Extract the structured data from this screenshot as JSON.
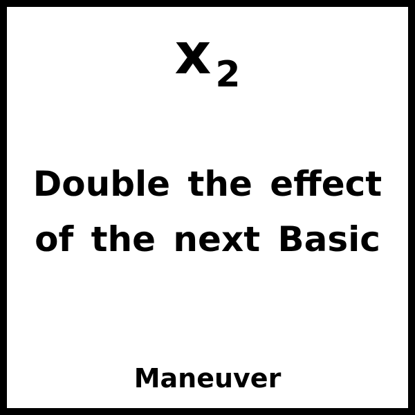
{
  "card": {
    "symbol": {
      "main": "x",
      "subscript": "2"
    },
    "effect_lines": [
      "Double the effect",
      "of the next Basic"
    ],
    "type": "Maneuver",
    "colors": {
      "border": "#000000",
      "background": "#ffffff",
      "text": "#000000"
    }
  }
}
